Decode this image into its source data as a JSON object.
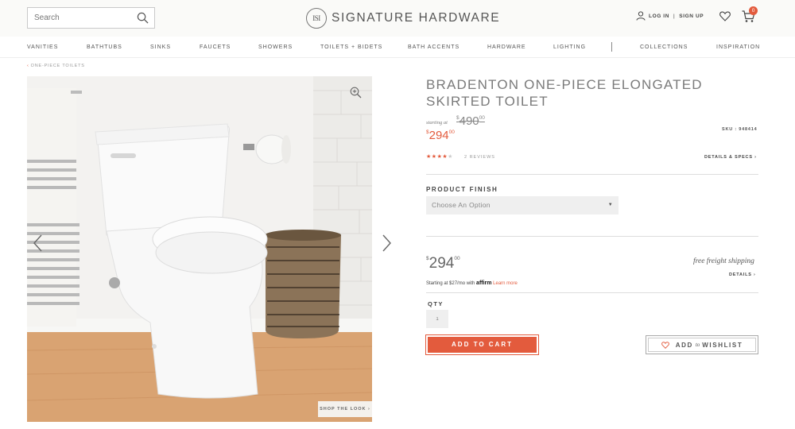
{
  "header": {
    "search_placeholder": "Search",
    "logo_mark": "ISI",
    "logo_text": "SIGNATURE HARDWARE",
    "login": "LOG IN",
    "separator": "|",
    "signup": "SIGN UP",
    "cart_count": "0"
  },
  "nav": {
    "items": [
      "VANITIES",
      "BATHTUBS",
      "SINKS",
      "FAUCETS",
      "SHOWERS",
      "TOILETS + BIDETS",
      "BATH ACCENTS",
      "HARDWARE",
      "LIGHTING",
      "COLLECTIONS",
      "INSPIRATION"
    ]
  },
  "breadcrumb": {
    "arrow": "‹",
    "label": "ONE-PIECE TOILETS"
  },
  "gallery": {
    "shop_the_look": "SHOP THE LOOK ›"
  },
  "product": {
    "title": "BRADENTON ONE-PIECE ELONGATED SKIRTED TOILET",
    "starting_at": "starting at",
    "old_price_symbol": "$",
    "old_price": "490",
    "old_price_cents": "00",
    "sale_price_symbol": "$",
    "sale_price": "294",
    "sale_price_cents": "00",
    "sku": "SKU : 948414",
    "rating": 4,
    "max_rating": 5,
    "stars_color": "#e35b3d",
    "reviews": "2 REVIEWS",
    "details_specs": "DETAILS & SPECS ›"
  },
  "finish": {
    "label": "PRODUCT FINISH",
    "selected": "Choose An Option",
    "caret": "▼"
  },
  "purchase": {
    "price_symbol": "$",
    "price": "294",
    "price_cents": "00",
    "free_shipping": "free freight shipping",
    "details": "DETAILS ›",
    "affirm_prefix": "Starting at $27/mo with",
    "affirm_brand": "affirm",
    "affirm_learn": "Learn more",
    "qty_label": "QTY",
    "qty_value": "1",
    "add_to_cart": "ADD TO CART",
    "add_label": "ADD",
    "to_label": "to",
    "wishlist_label": "WISHLIST"
  },
  "colors": {
    "accent": "#e35b3d",
    "text": "#555555",
    "header_bg": "#fafaf8"
  }
}
